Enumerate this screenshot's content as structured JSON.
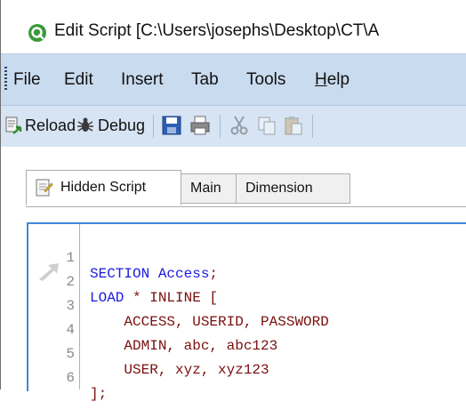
{
  "window": {
    "title": "Edit Script [C:\\Users\\josephs\\Desktop\\CT\\A"
  },
  "menu": {
    "items": [
      {
        "label": "File"
      },
      {
        "label": "Edit"
      },
      {
        "label": "Insert"
      },
      {
        "label": "Tab"
      },
      {
        "label": "Tools"
      },
      {
        "label": "Help",
        "mnemonic": "H",
        "rest": "elp"
      }
    ]
  },
  "toolbar": {
    "reload_label": "Reload",
    "debug_label": "Debug",
    "icons": [
      "reload-icon",
      "debug-icon",
      "save-icon",
      "print-icon",
      "cut-icon",
      "copy-icon",
      "paste-icon"
    ]
  },
  "tabs": [
    {
      "label": "Hidden Script",
      "active": true
    },
    {
      "label": "Main",
      "active": false
    },
    {
      "label": "Dimension",
      "active": false
    }
  ],
  "editor": {
    "lines": [
      {
        "number": "1",
        "kw": "SECTION Access",
        "rest": ";"
      },
      {
        "number": "2",
        "kw": "LOAD",
        "rest": " * INLINE ["
      },
      {
        "number": "3",
        "kw": "",
        "rest": "    ACCESS, USERID, PASSWORD"
      },
      {
        "number": "4",
        "kw": "",
        "rest": "    ADMIN, abc, abc123"
      },
      {
        "number": "5",
        "kw": "",
        "rest": "    USER, xyz, xyz123"
      },
      {
        "number": "6",
        "kw": "",
        "rest": "];"
      }
    ]
  },
  "colors": {
    "menubar_bg": "#c9dbef",
    "toolbar_bg": "#d6e4f3",
    "keyword": "#1a1ae0",
    "code_text": "#7a1010",
    "editor_border": "#3b8ad8"
  }
}
